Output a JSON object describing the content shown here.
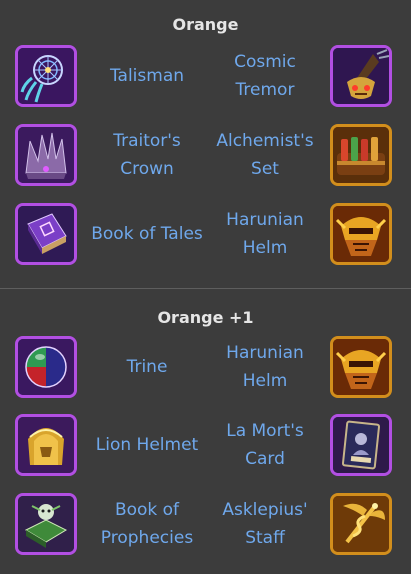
{
  "sections": [
    {
      "title": "Orange",
      "rows": [
        {
          "left": {
            "name": "Talisman",
            "icon": "talisman-icon",
            "frame": "purple"
          },
          "right": {
            "name": "Cosmic Tremor",
            "icon": "cosmic-tremor-icon",
            "frame": "purple"
          }
        },
        {
          "left": {
            "name": "Traitor's Crown",
            "icon": "traitors-crown-icon",
            "frame": "purple"
          },
          "right": {
            "name": "Alchemist's Set",
            "icon": "alchemists-set-icon",
            "frame": "orange"
          }
        },
        {
          "left": {
            "name": "Book of Tales",
            "icon": "book-of-tales-icon",
            "frame": "purple"
          },
          "right": {
            "name": "Harunian Helm",
            "icon": "harunian-helm-icon",
            "frame": "orange"
          }
        }
      ]
    },
    {
      "title": "Orange +1",
      "rows": [
        {
          "left": {
            "name": "Trine",
            "icon": "trine-icon",
            "frame": "purple"
          },
          "right": {
            "name": "Harunian Helm",
            "icon": "harunian-helm-icon",
            "frame": "orange"
          }
        },
        {
          "left": {
            "name": "Lion Helmet",
            "icon": "lion-helmet-icon",
            "frame": "purple"
          },
          "right": {
            "name": "La Mort's Card",
            "icon": "la-morts-card-icon",
            "frame": "purple"
          }
        },
        {
          "left": {
            "name": "Book of Prophecies",
            "icon": "book-of-prophecies-icon",
            "frame": "purple"
          },
          "right": {
            "name": "Asklepius' Staff",
            "icon": "asklepius-staff-icon",
            "frame": "orange"
          }
        }
      ]
    }
  ],
  "colors": {
    "background": "#3c3c3c",
    "title": "#e6e6e6",
    "item_label": "#6fa8ec",
    "purple_frame": "#b24fe3",
    "orange_frame": "#d28e1c"
  }
}
